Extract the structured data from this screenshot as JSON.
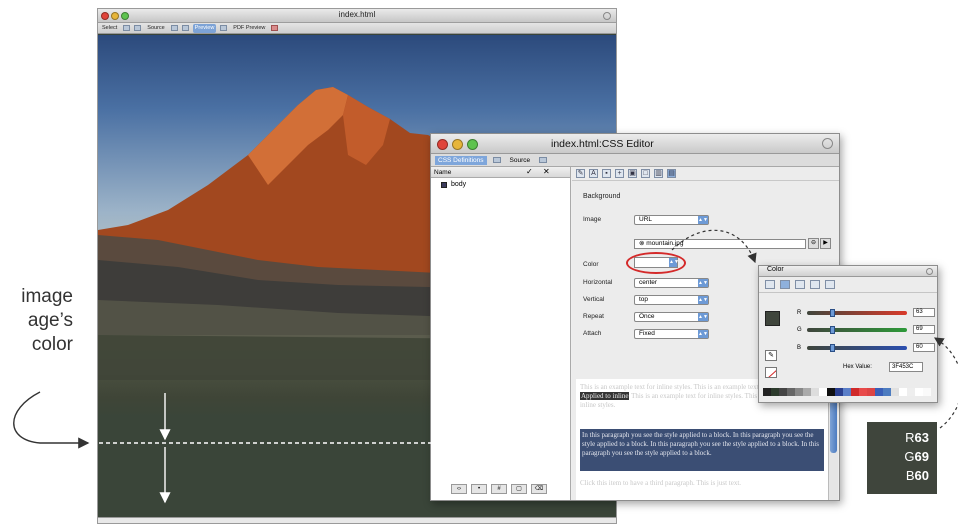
{
  "browser": {
    "title": "index.html",
    "toolbar": [
      "Select",
      "Source",
      "Preview",
      "PDF Preview"
    ],
    "active_tab": "Preview"
  },
  "callout": {
    "lines": [
      "image",
      "age’s",
      "color"
    ]
  },
  "editor": {
    "title": "index.html:CSS Editor",
    "tabs": {
      "definitions": "CSS Definitions",
      "source": "Source"
    },
    "list_header": "Name",
    "rule": "body",
    "section": "Background",
    "labels": {
      "image": "Image",
      "color": "Color",
      "horizontal": "Horizontal",
      "vertical": "Vertical",
      "repeat": "Repeat",
      "attach": "Attach"
    },
    "values": {
      "image_type": "URL",
      "image_url": "mountain.jpg",
      "horizontal": "center",
      "vertical": "top",
      "repeat": "Once",
      "attach": "Fixed"
    },
    "preview": {
      "inline_pre": "This is an example text for inline styles. This is an example text for inline styles.",
      "inline_highlight": "Applied to inline",
      "inline_post": "This is an example text for inline styles. This is an example text for inline styles.",
      "block": "In this paragraph you see the style applied to a block. In this paragraph you see the style applied to a block. In this paragraph you see the style applied to a block. In this paragraph you see the style applied to a block.",
      "tail": "Click this item to have a third paragraph. This is just text."
    }
  },
  "picker": {
    "title": "Color",
    "r_label": "R",
    "g_label": "G",
    "b_label": "B",
    "r": "63",
    "g": "69",
    "b": "60",
    "hex_label": "Hex Value:",
    "hex": "3F453C",
    "swatch_color": "#3F453C"
  },
  "badge": {
    "r_label": "R",
    "r": "63",
    "g_label": "G",
    "g": "69",
    "b_label": "B",
    "b": "60"
  },
  "colors": {
    "page_bg": "#3F453C",
    "accent": "#6d9ad6",
    "highlight_red": "#d42a2a"
  }
}
